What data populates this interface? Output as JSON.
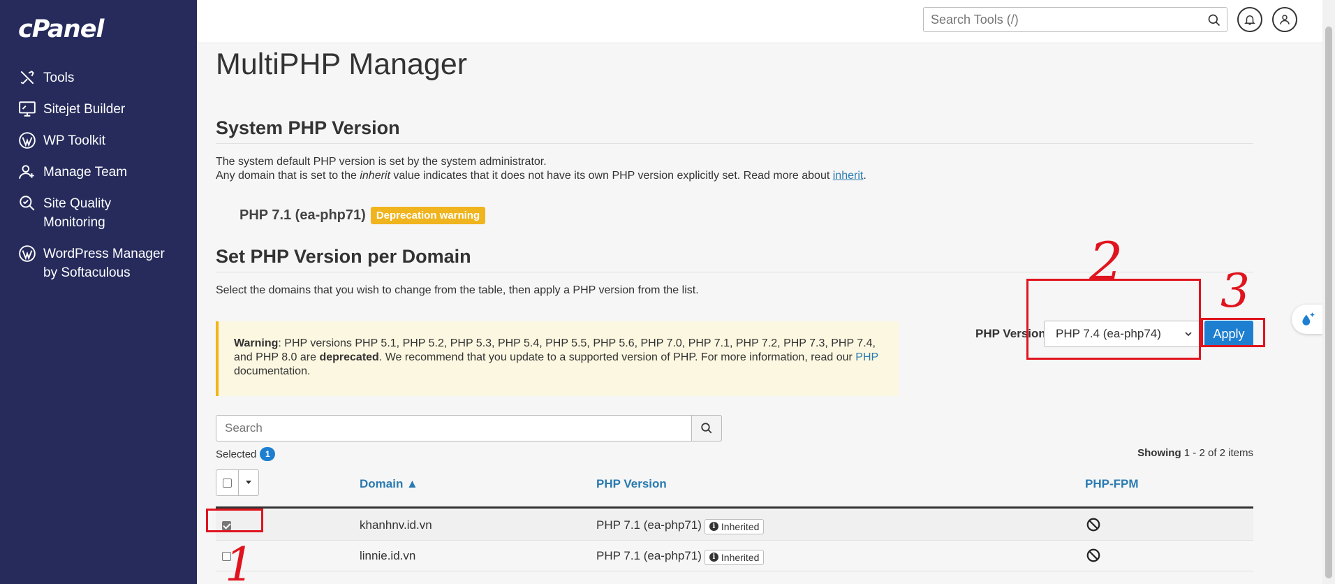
{
  "app": {
    "logo": "cPanel"
  },
  "sidebar": {
    "items": [
      {
        "label": "Tools",
        "icon": "tools-icon"
      },
      {
        "label": "Sitejet Builder",
        "icon": "monitor-icon"
      },
      {
        "label": "WP Toolkit",
        "icon": "wordpress-icon"
      },
      {
        "label": "Manage Team",
        "icon": "team-icon"
      },
      {
        "label": "Site Quality\nMonitoring",
        "icon": "magnifier-icon"
      },
      {
        "label": "WordPress Manager\nby Softaculous",
        "icon": "wordpress-icon"
      }
    ]
  },
  "header": {
    "search_placeholder": "Search Tools (/)"
  },
  "page": {
    "title": "MultiPHP Manager",
    "system_section": {
      "heading": "System PHP Version",
      "line1": "The system default PHP version is set by the system administrator.",
      "line2_prefix": "Any domain that is set to the ",
      "line2_em": "inherit",
      "line2_mid": " value indicates that it does not have its own PHP version explicitly set. Read more about ",
      "line2_link": "inherit",
      "line2_end": ".",
      "current_version": "PHP 7.1 (ea-php71)",
      "deprecation_badge": "Deprecation warning"
    },
    "domain_section": {
      "heading": "Set PHP Version per Domain",
      "description": "Select the domains that you wish to change from the table, then apply a PHP version from the list.",
      "warning_label": "Warning",
      "warning_text1": ": PHP versions PHP 5.1, PHP 5.2, PHP 5.3, PHP 5.4, PHP 5.5, PHP 5.6, PHP 7.0, PHP 7.1, PHP 7.2, PHP 7.3, PHP 7.4, and PHP 8.0 are ",
      "warning_bold": "deprecated",
      "warning_text2": ". We recommend that you update to a supported version of PHP. For more information, read our ",
      "warning_link": "PHP",
      "warning_text3": " documentation.",
      "php_version_label": "PHP Version",
      "php_version_selected": "PHP 7.4 (ea-php74)",
      "apply_label": "Apply"
    },
    "table": {
      "search_placeholder": "Search",
      "selected_label": "Selected",
      "selected_count": "1",
      "showing_label": "Showing",
      "showing_range": " 1 - 2 of 2 items",
      "columns": [
        "Domain ▲",
        "PHP Version",
        "PHP-FPM"
      ],
      "rows": [
        {
          "domain": "khanhnv.id.vn",
          "php": "PHP 7.1 (ea-php71)",
          "badge": "Inherited",
          "checked": true
        },
        {
          "domain": "linnie.id.vn",
          "php": "PHP 7.1 (ea-php71)",
          "badge": "Inherited",
          "checked": false
        }
      ]
    }
  },
  "annotations": [
    "1",
    "2",
    "3"
  ],
  "colors": {
    "sidebar": "#262b5c",
    "accent": "#1e7fd1",
    "warning": "#f0b41e",
    "annotation": "#e0141e"
  }
}
